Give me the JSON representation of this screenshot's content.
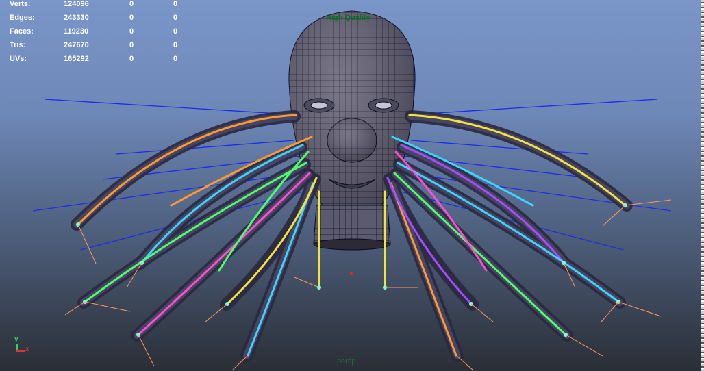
{
  "stats": [
    {
      "label": "Verts:",
      "values": [
        "124096",
        "0",
        "0"
      ]
    },
    {
      "label": "Edges:",
      "values": [
        "243330",
        "0",
        "0"
      ]
    },
    {
      "label": "Faces:",
      "values": [
        "119230",
        "0",
        "0"
      ]
    },
    {
      "label": "Tris:",
      "values": [
        "247670",
        "0",
        "0"
      ]
    },
    {
      "label": "UVs:",
      "values": [
        "165292",
        "0",
        "0"
      ]
    }
  ],
  "viewport": {
    "quality_label": "High Quality",
    "camera_label": "persp",
    "axis_y": "y",
    "axis_x": "x"
  },
  "colors": {
    "mesh": "#5c5a6e",
    "wire": "#0d0a22",
    "curve_blue": "#1a2ee8",
    "joint_orange": "#ff9a5a"
  }
}
